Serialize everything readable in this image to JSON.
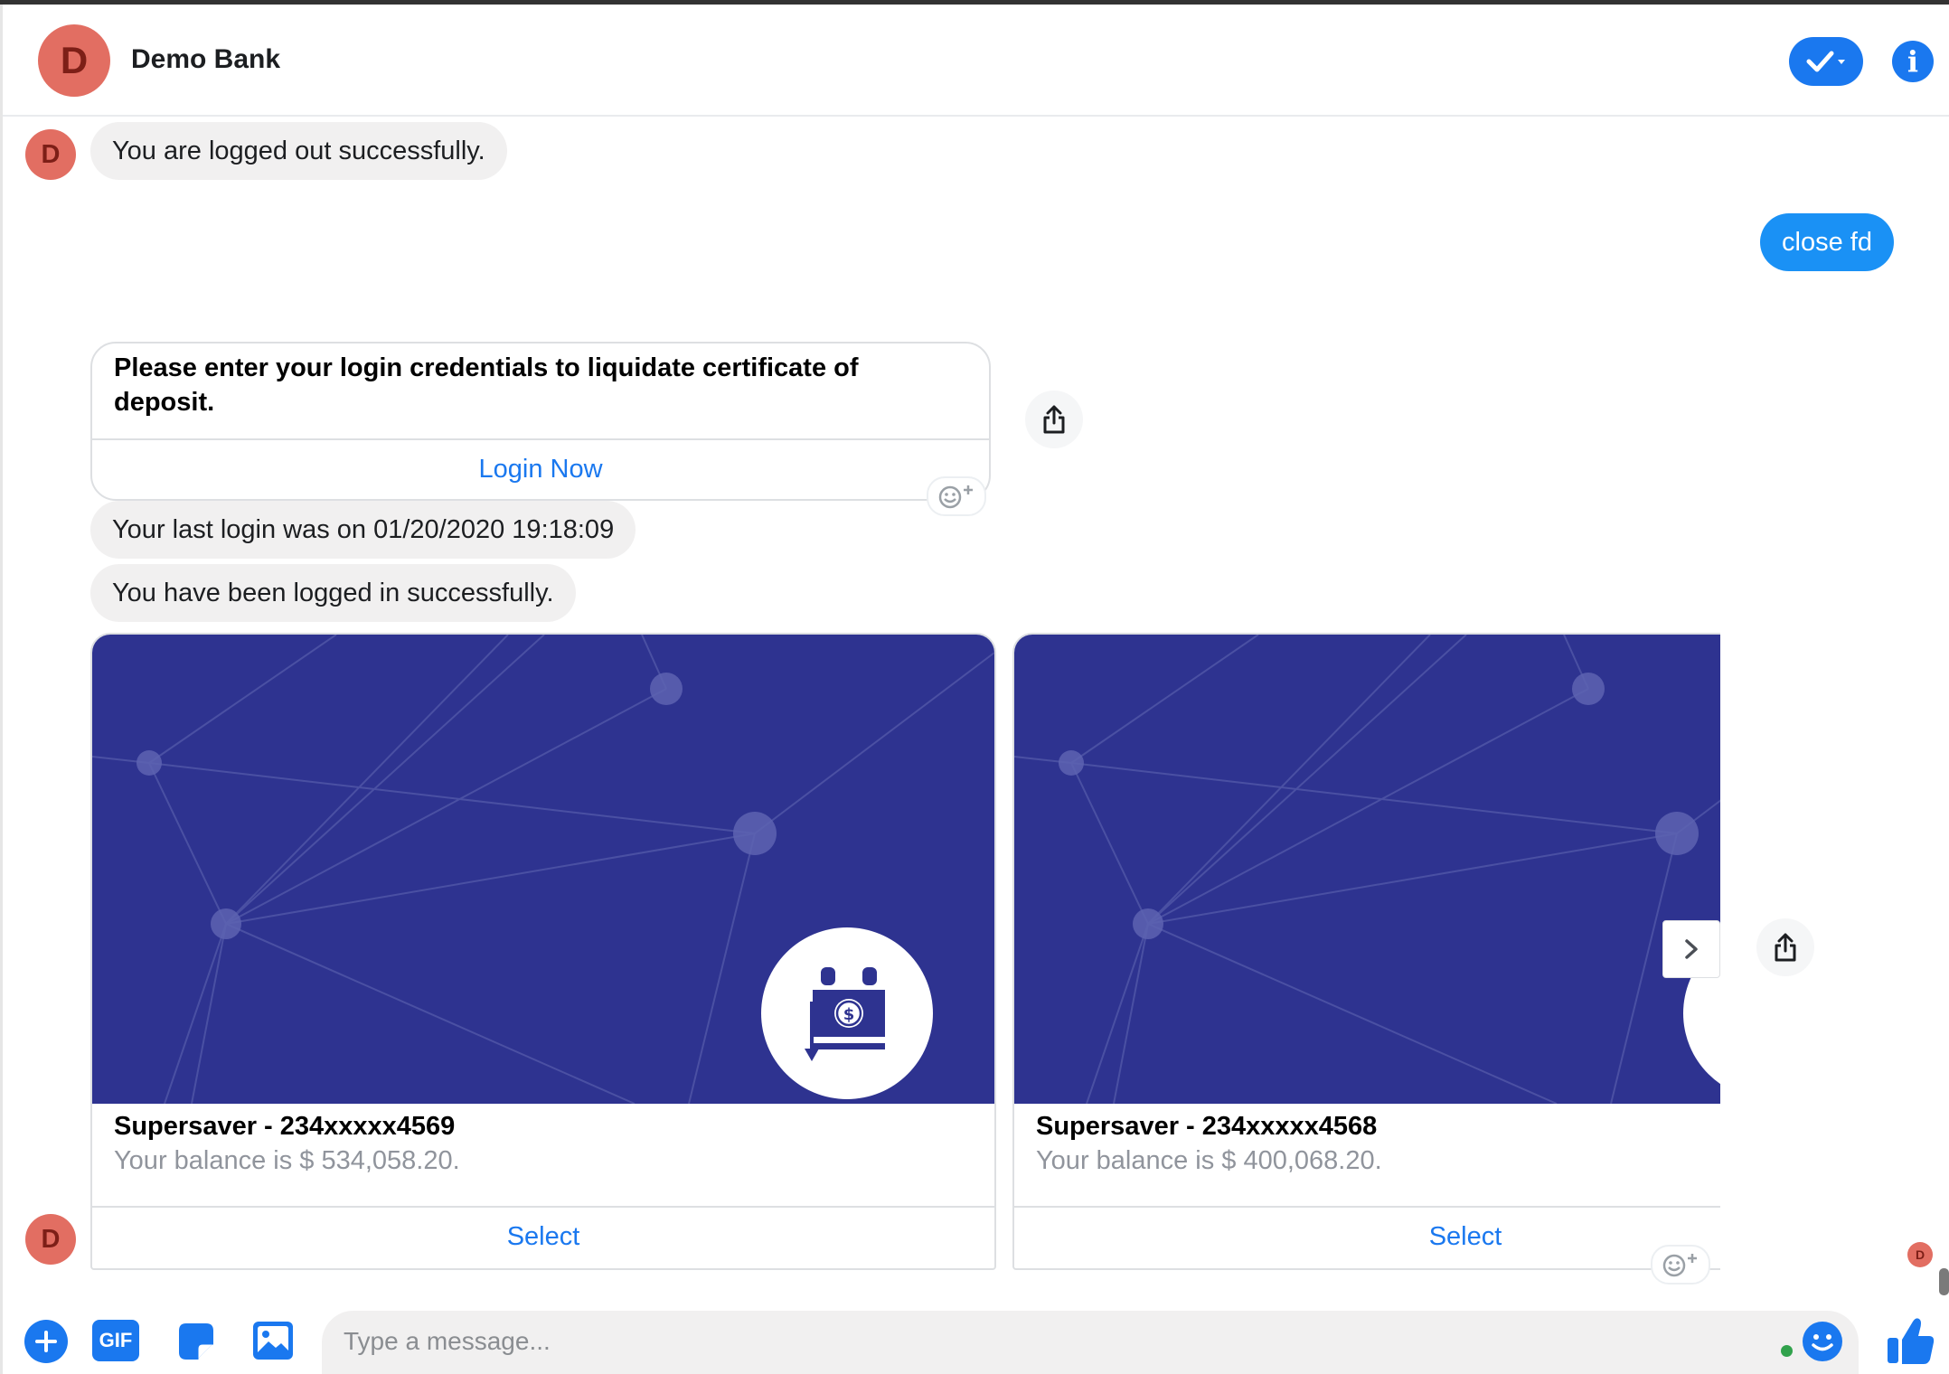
{
  "header": {
    "avatar_letter": "D",
    "title": "Demo Bank",
    "check_icon": "check-dropdown-icon",
    "info_icon": "info-icon",
    "info_glyph": "i"
  },
  "avatar_letter": "D",
  "messages": {
    "logged_out": "You are logged out successfully.",
    "user_close": "close fd",
    "login_prompt": "Please enter your login credentials to liquidate certificate of deposit.",
    "login_button": "Login Now",
    "last_login": "Your last login was on 01/20/2020 19:18:09",
    "logged_in": "You have been logged in successfully."
  },
  "cards": [
    {
      "title": "Supersaver - 234xxxxx4569",
      "subtitle": "Your balance is $ 534,058.20.",
      "button": "Select",
      "icon": "money-exchange-icon"
    },
    {
      "title": "Supersaver - 234xxxxx4568",
      "subtitle": "Your balance is $ 400,068.20.",
      "button": "Select",
      "icon": "money-exchange-icon"
    }
  ],
  "composer": {
    "placeholder": "Type a message...",
    "gif_label": "GIF",
    "tools": [
      "plus-icon",
      "gif-icon",
      "sticker-icon",
      "image-icon",
      "emoji-icon",
      "thumbs-up-icon"
    ]
  },
  "colors": {
    "accent": "#1a78ef",
    "outgoing_bubble": "#1a91f5",
    "avatar": "#e26e62",
    "card_bg": "#2e3390",
    "incoming_bubble": "#f1f0f0"
  }
}
